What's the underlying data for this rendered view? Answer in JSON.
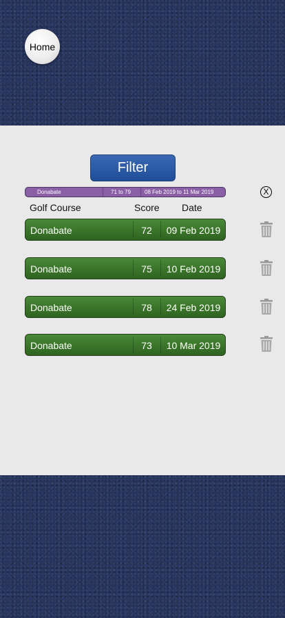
{
  "nav": {
    "home_label": "Home"
  },
  "filter": {
    "button_label": "Filter",
    "summary": {
      "course": "Donabate",
      "score_range": "71 to 79",
      "date_range": "08 Feb 2019 to 11 Mar 2019"
    },
    "clear_label": "X"
  },
  "table": {
    "headers": {
      "course": "Golf Course",
      "score": "Score",
      "date": "Date"
    },
    "rows": [
      {
        "course": "Donabate",
        "score": "72",
        "date": "09 Feb 2019"
      },
      {
        "course": "Donabate",
        "score": "75",
        "date": "10 Feb 2019"
      },
      {
        "course": " Donabate",
        "score": "78",
        "date": "24 Feb 2019"
      },
      {
        "course": "Donabate",
        "score": "73",
        "date": "10 Mar 2019"
      }
    ]
  },
  "icons": {
    "home": "golf-ball-icon",
    "delete": "trash-icon",
    "clear": "close-circle-icon"
  },
  "colors": {
    "filter_button": "#2a5aa6",
    "summary_bar": "#8a5fa6",
    "row": "#3f7b2f",
    "panel": "#e9e9e9",
    "background": "#27355f"
  }
}
